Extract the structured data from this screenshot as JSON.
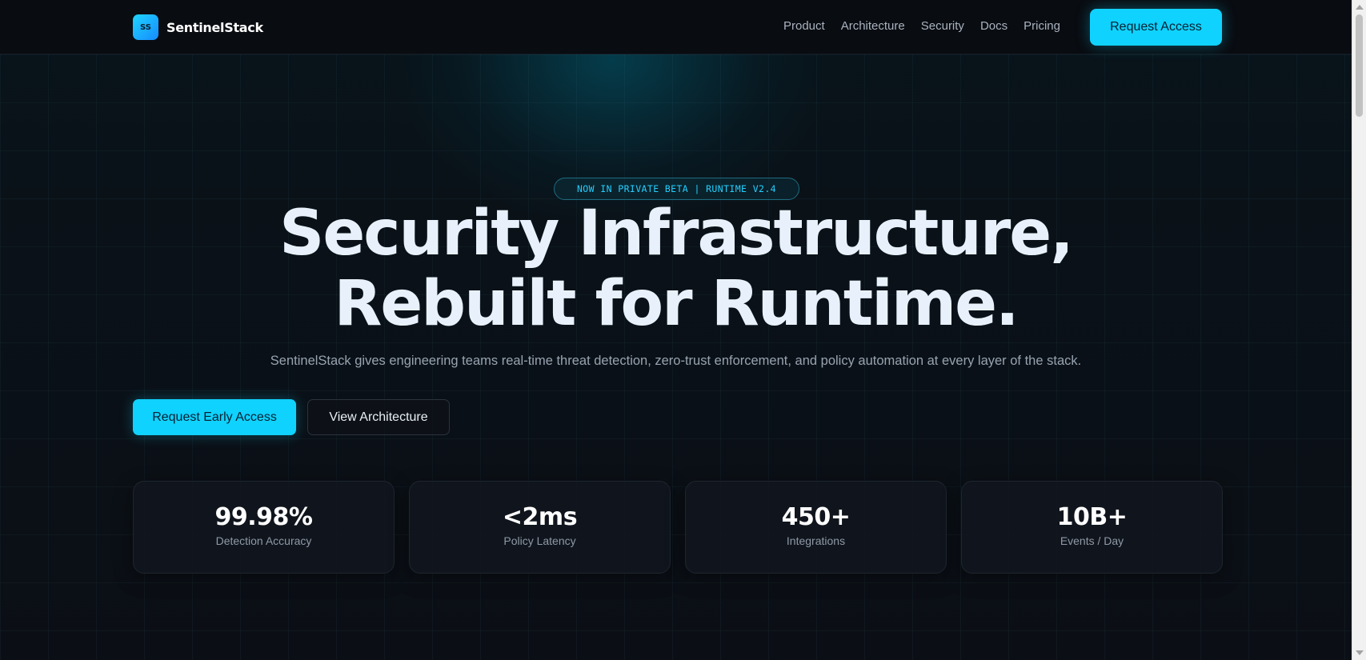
{
  "nav": {
    "brand_mark": "SS",
    "brand_name": "SentinelStack",
    "links": [
      "Product",
      "Architecture",
      "Security",
      "Docs",
      "Pricing"
    ],
    "cta_label": "Request Access"
  },
  "hero": {
    "badge": "NOW IN PRIVATE BETA | RUNTIME V2.4",
    "headline_line1": "Security Infrastructure,",
    "headline_line2": "Rebuilt for Runtime.",
    "subtitle": "SentinelStack gives engineering teams real-time threat detection, zero-trust enforcement, and policy automation at every layer of the stack.",
    "primary_button": "Request Early Access",
    "secondary_button": "View Architecture"
  },
  "stats": [
    {
      "value": "99.98%",
      "label": "Detection Accuracy"
    },
    {
      "value": "<2ms",
      "label": "Policy Latency"
    },
    {
      "value": "450+",
      "label": "Integrations"
    },
    {
      "value": "10B+",
      "label": "Events / Day"
    }
  ],
  "colors": {
    "accent": "#10d2ff",
    "background": "#0a0e14",
    "badge_text": "#24cfff"
  }
}
